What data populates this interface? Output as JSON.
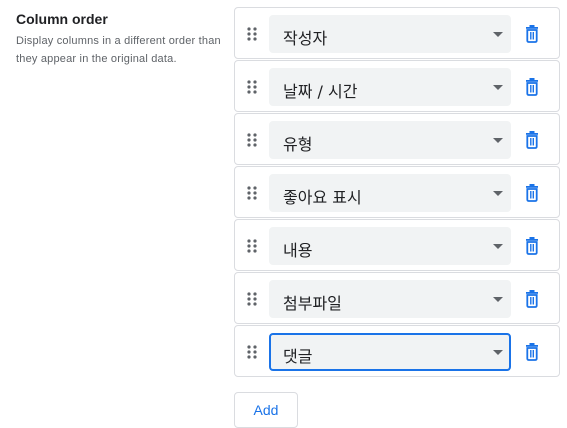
{
  "setting": {
    "title": "Column order",
    "description": "Display columns in a different order than they appear in the original data."
  },
  "columns": [
    {
      "value": "작성자"
    },
    {
      "value": "날짜 / 시간"
    },
    {
      "value": "유형"
    },
    {
      "value": "좋아요 표시"
    },
    {
      "value": "내용"
    },
    {
      "value": "첨부파일"
    },
    {
      "value": "댓글"
    }
  ],
  "focused_index": 6,
  "add_label": "Add",
  "colors": {
    "accent": "#1a73e8",
    "select_bg": "#f1f3f4",
    "border": "#dadce0"
  },
  "icons": {
    "drag": "drag-indicator-icon",
    "delete": "trash-icon",
    "dropdown": "arrow-drop-down-icon"
  }
}
